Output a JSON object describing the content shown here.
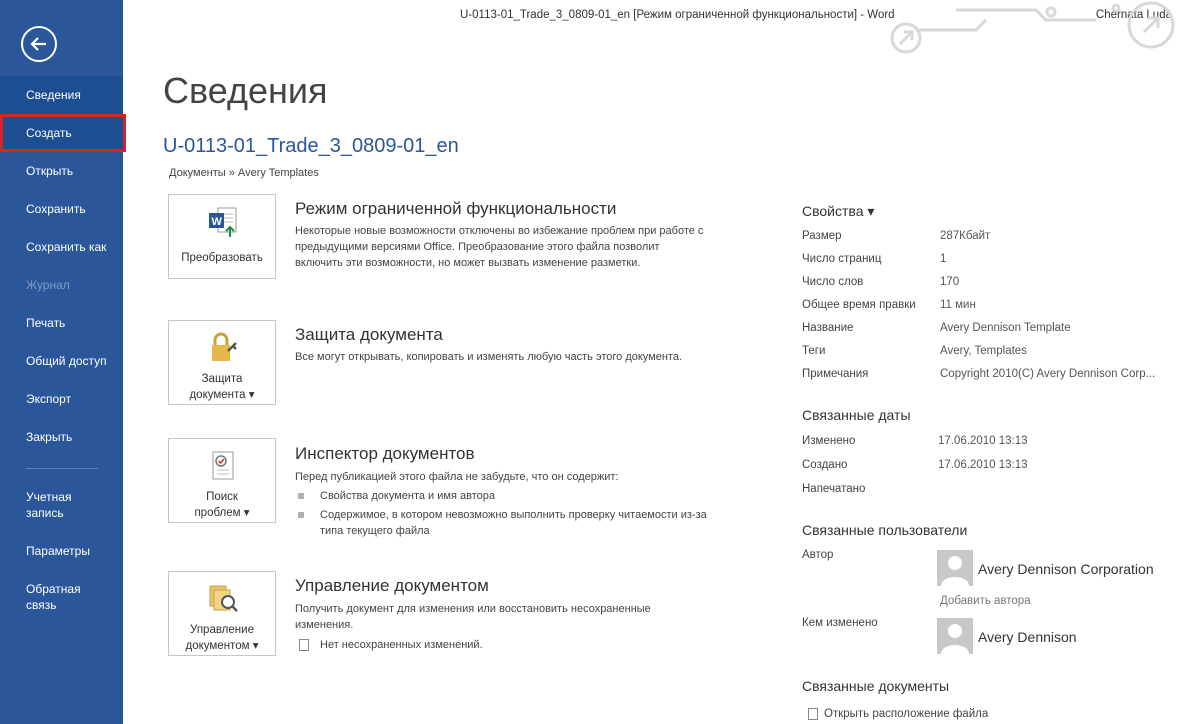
{
  "window": {
    "title": "U-0113-01_Trade_3_0809-01_en [Режим ограниченной функциональности] - Word",
    "user": "Chernata Luda"
  },
  "sidebar": {
    "items": [
      {
        "label": "Сведения"
      },
      {
        "label": "Создать"
      },
      {
        "label": "Открыть"
      },
      {
        "label": "Сохранить"
      },
      {
        "label": "Сохранить как"
      },
      {
        "label": "Журнал"
      },
      {
        "label": "Печать"
      },
      {
        "label": "Общий доступ"
      },
      {
        "label": "Экспорт"
      },
      {
        "label": "Закрыть"
      },
      {
        "label_1": "Учетная",
        "label_2": "запись"
      },
      {
        "label": "Параметры"
      },
      {
        "label_1": "Обратная",
        "label_2": "связь"
      }
    ]
  },
  "main": {
    "title": "Сведения",
    "doc_name": "U-0113-01_Trade_3_0809-01_en",
    "breadcrumb": "Документы » Avery Templates",
    "sections": [
      {
        "button_1": "Преобразовать",
        "title": "Режим ограниченной функциональности",
        "text": "Некоторые новые возможности отключены во избежание проблем при работе с предыдущими версиями Office. Преобразование этого файла позволит включить эти возможности, но может вызвать изменение разметки."
      },
      {
        "button_1": "Защита",
        "button_2": "документа ▾",
        "title": "Защита документа",
        "text": "Все могут открывать, копировать и изменять любую часть этого документа."
      },
      {
        "button_1": "Поиск",
        "button_2": "проблем ▾",
        "title": "Инспектор документов",
        "text": "Перед публикацией этого файла не забудьте, что он содержит:",
        "bullets": [
          "Свойства документа и имя автора",
          "Содержимое, в котором невозможно выполнить проверку читаемости из-за типа текущего файла"
        ]
      },
      {
        "button_1": "Управление",
        "button_2": "документом ▾",
        "title": "Управление документом",
        "text": "Получить документ для изменения или восстановить несохраненные изменения.",
        "note": "Нет несохраненных изменений."
      }
    ]
  },
  "properties": {
    "heading": "Свойства ▾",
    "rows": [
      {
        "k": "Размер",
        "v": "287Кбайт"
      },
      {
        "k": "Число страниц",
        "v": "1"
      },
      {
        "k": "Число слов",
        "v": "170"
      },
      {
        "k": "Общее время правки",
        "v": "11 мин"
      },
      {
        "k": "Название",
        "v": "Avery Dennison Template"
      },
      {
        "k": "Теги",
        "v": "Avery, Templates"
      },
      {
        "k": "Примечания",
        "v": "Copyright 2010(C) Avery Dennison Corp..."
      }
    ],
    "dates_heading": "Связанные даты",
    "dates": [
      {
        "k": "Изменено",
        "v": "17.06.2010 13:13"
      },
      {
        "k": "Создано",
        "v": "17.06.2010 13:13"
      },
      {
        "k": "Напечатано",
        "v": ""
      }
    ],
    "people_heading": "Связанные пользователи",
    "author_label": "Автор",
    "author_name": "Avery Dennison Corporation",
    "add_author": "Добавить автора",
    "modified_by_label": "Кем изменено",
    "modified_by_name": "Avery Dennison",
    "docs_heading": "Связанные документы",
    "open_location": "Открыть расположение файла"
  },
  "colors": {
    "sidebar": "#2b579a",
    "highlight": "#d6232a",
    "accent": "#2b579a"
  }
}
